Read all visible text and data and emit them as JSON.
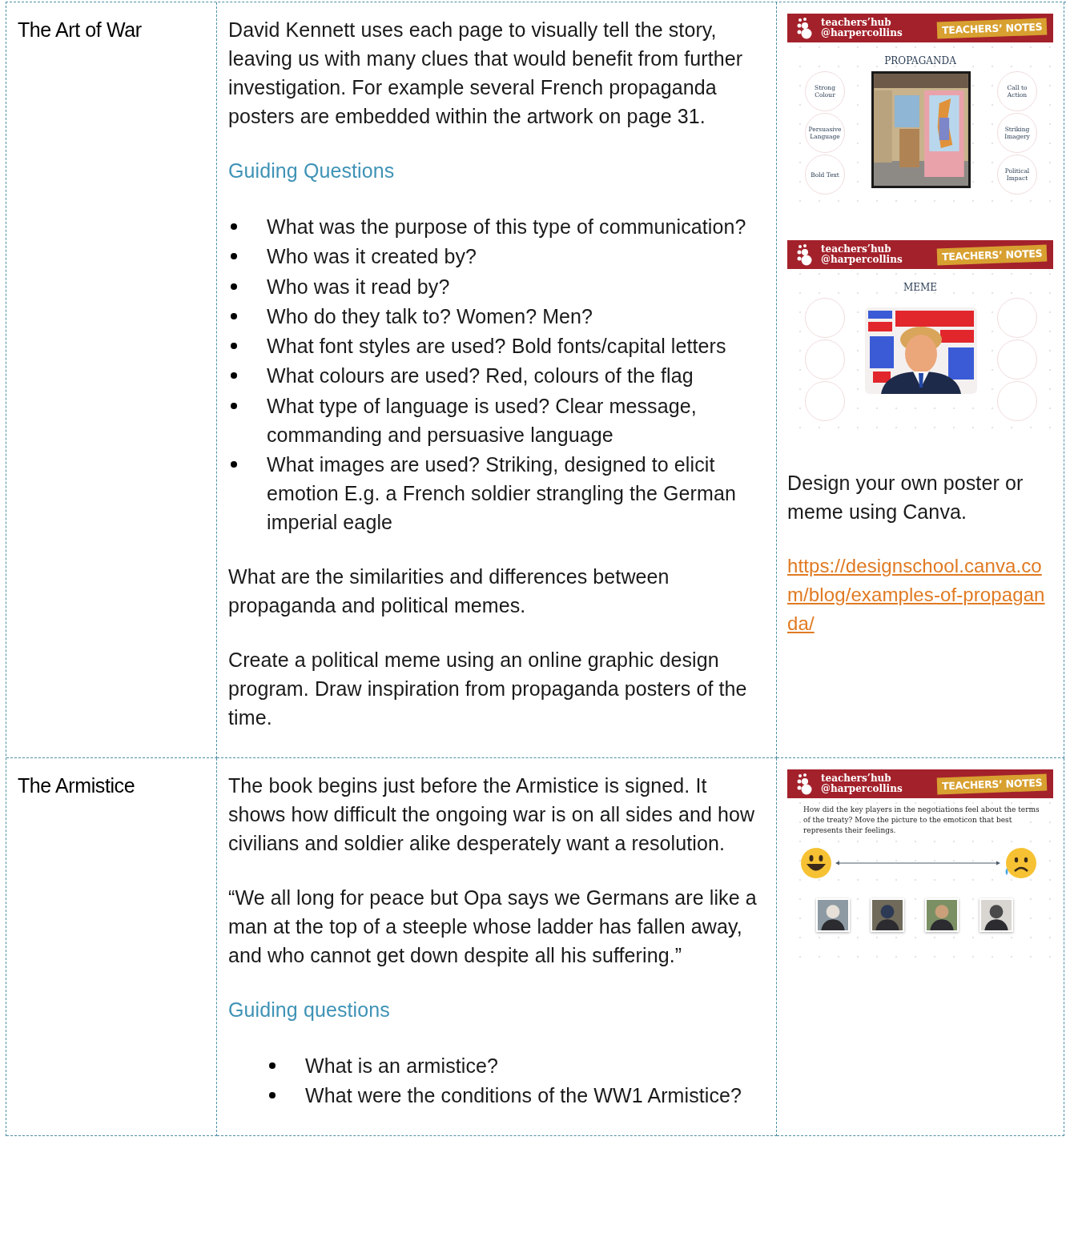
{
  "rows": [
    {
      "topic": "The Art of War",
      "body": [
        {
          "kind": "paragraph",
          "text": "David Kennett uses each page to visually tell the story, leaving us with many clues that would benefit from further investigation.  For example several French propaganda posters are embedded within the artwork on page 31."
        },
        {
          "kind": "heading",
          "text": "Guiding Questions"
        },
        {
          "kind": "bullets",
          "items": [
            "What was the purpose of this type of communication?",
            "Who was it created by?",
            "Who was it read by?",
            "Who do they talk to? Women? Men?",
            "What font styles are used? Bold fonts/capital letters",
            "What colours are used? Red, colours of the flag",
            "What type of language is used? Clear message, commanding and persuasive language",
            "What images are used? Striking, designed to elicit emotion E.g. a French soldier strangling the German imperial eagle"
          ]
        },
        {
          "kind": "paragraph",
          "text": "What are the similarities and differences between propaganda and political memes."
        },
        {
          "kind": "paragraph",
          "text": "Create a political meme using an online graphic design program. Draw inspiration from propaganda posters of the time."
        }
      ],
      "slides": [
        {
          "kind": "propaganda",
          "header": {
            "brand_top": "teachers’hub",
            "brand_bottom": "@harpercollins",
            "tag": "TEACHERS’ NOTES"
          },
          "title": "PROPAGANDA",
          "left_labels": [
            "Strong Colour",
            "Persuasive Language",
            "Bold Text"
          ],
          "right_labels": [
            "Call to Action",
            "Striking Imagery",
            "Political Impact"
          ]
        },
        {
          "kind": "meme",
          "header": {
            "brand_top": "teachers’hub",
            "brand_bottom": "@harpercollins",
            "tag": "TEACHERS’ NOTES"
          },
          "title": "MEME"
        }
      ],
      "side": [
        {
          "kind": "paragraph",
          "text": "Design your own poster or meme using Canva."
        },
        {
          "kind": "link",
          "text": "https://designschool.canva.com/blog/examples-of-propaganda/"
        }
      ]
    },
    {
      "topic": "The Armistice",
      "body": [
        {
          "kind": "paragraph",
          "text": "The book begins just before the Armistice is signed. It shows how difficult the ongoing war is on all sides and how civilians and soldier alike desperately want a resolution."
        },
        {
          "kind": "paragraph",
          "text": "“We all long for peace but Opa says we Germans are like a man at the top of a steeple whose ladder has fallen away, and who cannot get down despite all his suffering.”"
        },
        {
          "kind": "heading",
          "text": "Guiding questions"
        },
        {
          "kind": "indented_bullets",
          "items": [
            "What is an armistice?",
            "What were the conditions of the WW1 Armistice?"
          ]
        }
      ],
      "slides": [
        {
          "kind": "emoticon_scale",
          "header": {
            "brand_top": "teachers’hub",
            "brand_bottom": "@harpercollins",
            "tag": "TEACHERS’ NOTES"
          },
          "prompt": "How did the key players in the negotiations feel about the terms of the treaty? Move the picture to the emoticon that best represents their feelings."
        }
      ],
      "side": []
    }
  ]
}
